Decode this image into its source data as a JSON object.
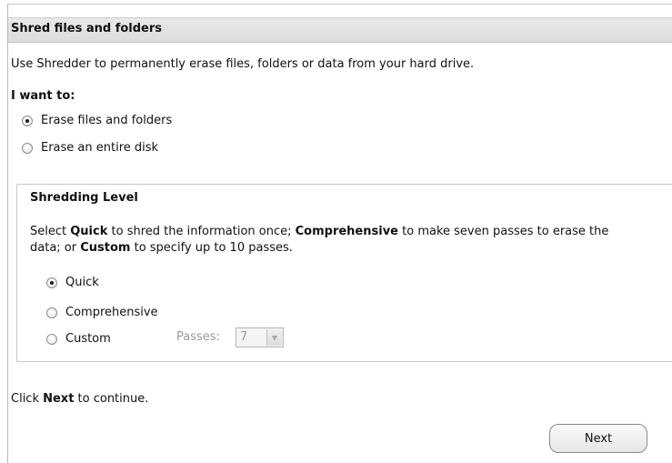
{
  "header": {
    "title": "Shred files and folders"
  },
  "intro": {
    "description": "Use Shredder to permanently erase files, folders or data from your hard drive."
  },
  "target": {
    "label": "I want to:",
    "options": [
      {
        "label": "Erase files and folders",
        "selected": true
      },
      {
        "label": "Erase an entire disk",
        "selected": false
      }
    ]
  },
  "shredding": {
    "title": "Shredding Level",
    "text": {
      "p1": "Select ",
      "quick": "Quick",
      "p2": " to shred the information once; ",
      "comprehensive": "Comprehensive",
      "p3": " to make seven passes to erase the data; or ",
      "custom": "Custom",
      "p4": " to specify up to 10 passes."
    },
    "options": [
      {
        "label": "Quick",
        "selected": true
      },
      {
        "label": "Comprehensive",
        "selected": false
      },
      {
        "label": "Custom",
        "selected": false
      }
    ],
    "passes_label": "Passes:",
    "passes_value": "7"
  },
  "footer": {
    "continue_prefix": "Click ",
    "continue_bold": "Next",
    "continue_suffix": " to continue.",
    "next_label": "Next"
  }
}
